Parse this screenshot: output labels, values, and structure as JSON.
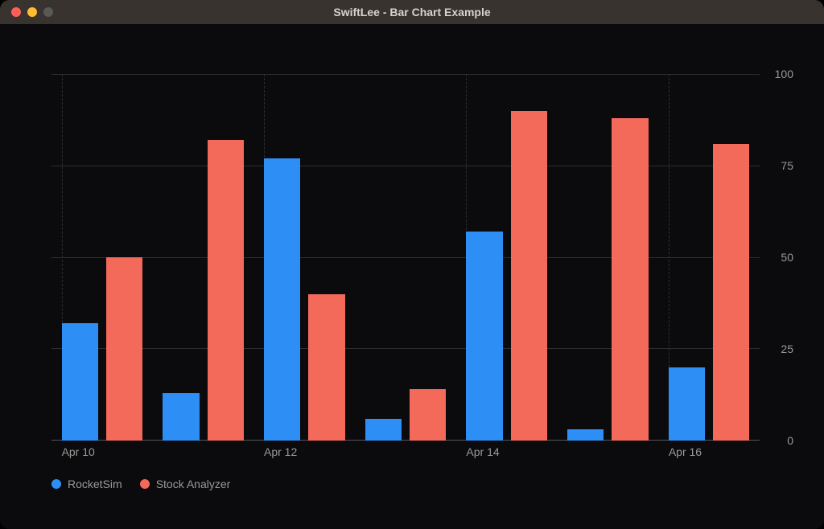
{
  "window": {
    "title": "SwiftLee - Bar Chart Example"
  },
  "legend": {
    "series0": "RocketSim",
    "series1": "Stock Analyzer"
  },
  "axes": {
    "y_ticks": [
      "0",
      "25",
      "50",
      "75",
      "100"
    ],
    "x_ticks": [
      "Apr 10",
      "Apr 12",
      "Apr 14",
      "Apr 16"
    ]
  },
  "chart_data": {
    "type": "bar",
    "title": "",
    "xlabel": "",
    "ylabel": "",
    "ylim": [
      0,
      100
    ],
    "grid": true,
    "legend_position": "bottom",
    "categories": [
      "Apr 10",
      "Apr 11",
      "Apr 12",
      "Apr 13",
      "Apr 14",
      "Apr 15",
      "Apr 16"
    ],
    "x_tick_labels_shown": [
      "Apr 10",
      "Apr 12",
      "Apr 14",
      "Apr 16"
    ],
    "y_ticks": [
      0,
      25,
      50,
      75,
      100
    ],
    "series": [
      {
        "name": "RocketSim",
        "color": "#2d8ef5",
        "values": [
          32,
          13,
          77,
          6,
          57,
          3,
          20
        ]
      },
      {
        "name": "Stock Analyzer",
        "color": "#f3695a",
        "values": [
          50,
          82,
          40,
          14,
          90,
          88,
          81
        ]
      }
    ]
  }
}
